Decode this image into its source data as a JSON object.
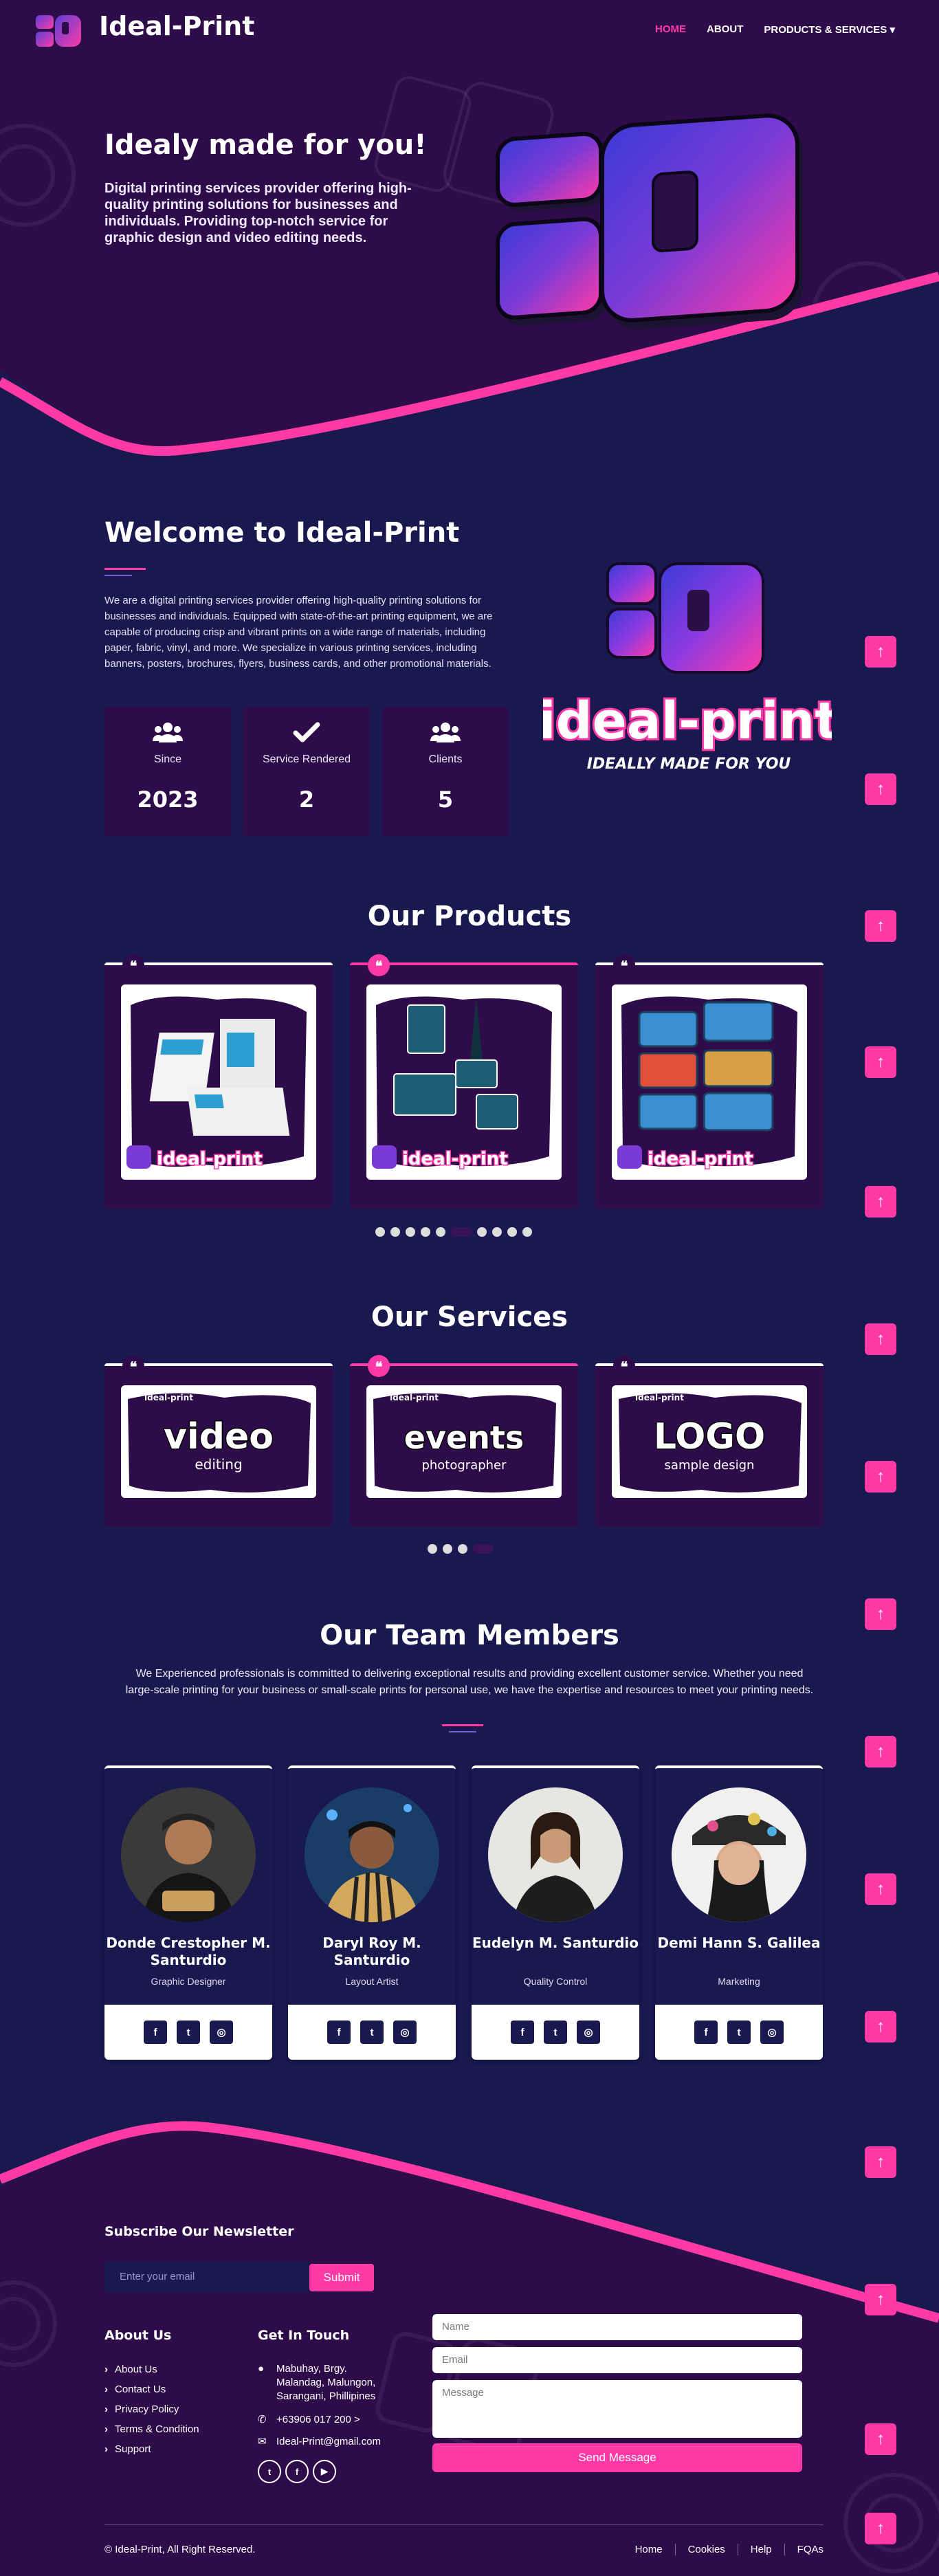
{
  "nav": {
    "brand": "Ideal-Print",
    "menu": [
      {
        "label": "HOME",
        "active": true
      },
      {
        "label": "ABOUT"
      },
      {
        "label": "PRODUCTS & SERVICES ▾"
      }
    ]
  },
  "hero": {
    "title": "Idealy made for you!",
    "text": "Digital printing services provider offering high-quality printing solutions for businesses and individuals. Providing top-notch service for graphic design and video editing needs."
  },
  "welcome": {
    "title": "Welcome to Ideal-Print",
    "text": "We are a digital printing services provider offering high-quality printing solutions for businesses and individuals. Equipped with state-of-the-art printing equipment, we are capable of producing crisp and vibrant prints on a wide range of materials, including paper, fabric, vinyl, and more. We specialize in various printing services, including banners, posters, brochures, flyers, business cards, and other promotional materials.",
    "stats": [
      {
        "icon": "users-cog-icon",
        "label": "Since",
        "value": "2023"
      },
      {
        "icon": "check-icon",
        "label": "Service Rendered",
        "value": "2"
      },
      {
        "icon": "users-icon",
        "label": "Clients",
        "value": "5"
      }
    ],
    "logo_text": "ideal-print",
    "logo_tagline": "IDEALLY MADE FOR YOU"
  },
  "products": {
    "title": "Our Products",
    "items": [
      {
        "image": "brochure-mockup",
        "stamp": "ideal-print"
      },
      {
        "image": "id-lanyard-mockup",
        "stamp": "ideal-print"
      },
      {
        "image": "open-closed-signs-mockup",
        "stamp": "ideal-print"
      }
    ],
    "dots_count": 10,
    "active_dot": 5
  },
  "services": {
    "title": "Our Services",
    "items": [
      {
        "word": "video",
        "sub": "editing",
        "stamp": "ideal-print"
      },
      {
        "word": "events",
        "sub": "photographer",
        "stamp": "ideal-print"
      },
      {
        "word": "LOGO",
        "sub": "sample design",
        "stamp": "ideal-print"
      }
    ],
    "dots_count": 4,
    "active_dot": 3
  },
  "team": {
    "title": "Our Team Members",
    "text": "We Experienced professionals is committed to delivering exceptional results and providing excellent customer service. Whether you need large-scale printing for your business or small-scale prints for personal use, we have the expertise and resources to meet your printing needs.",
    "members": [
      {
        "name": "Donde Crestopher M. Santurdio",
        "role": "Graphic Designer"
      },
      {
        "name": "Daryl Roy M. Santurdio",
        "role": "Layout Artist"
      },
      {
        "name": "Eudelyn M. Santurdio",
        "role": "Quality Control"
      },
      {
        "name": "Demi Hann S. Galilea",
        "role": "Marketing"
      }
    ],
    "social": [
      "f",
      "t",
      "ig"
    ]
  },
  "footer": {
    "newsletter_title": "Subscribe Our Newsletter",
    "newsletter_placeholder": "Enter your email",
    "newsletter_button": "Submit",
    "about_title": "About Us",
    "about_links": [
      "About Us",
      "Contact Us",
      "Privacy Policy",
      "Terms & Condition",
      "Support"
    ],
    "touch_title": "Get In Touch",
    "address": "Mabuhay, Brgy. Malandag, Malungon, Sarangani, Phillipines",
    "phone": "+63906 017 200 >",
    "email": "Ideal-Print@gmail.com",
    "form": {
      "name_placeholder": "Name",
      "email_placeholder": "Email",
      "message_placeholder": "Message",
      "send_button": "Send Message"
    },
    "copyright_prefix": "©",
    "copyright_brand": "Ideal-Print",
    "copyright_suffix": ", All Right Reserved.",
    "bottom_links": [
      "Home",
      "Cookies",
      "Help",
      "FQAs"
    ]
  },
  "colors": {
    "accent": "#ff3aa7",
    "dark_purple": "#2e0c4a",
    "navy": "#19184f"
  }
}
